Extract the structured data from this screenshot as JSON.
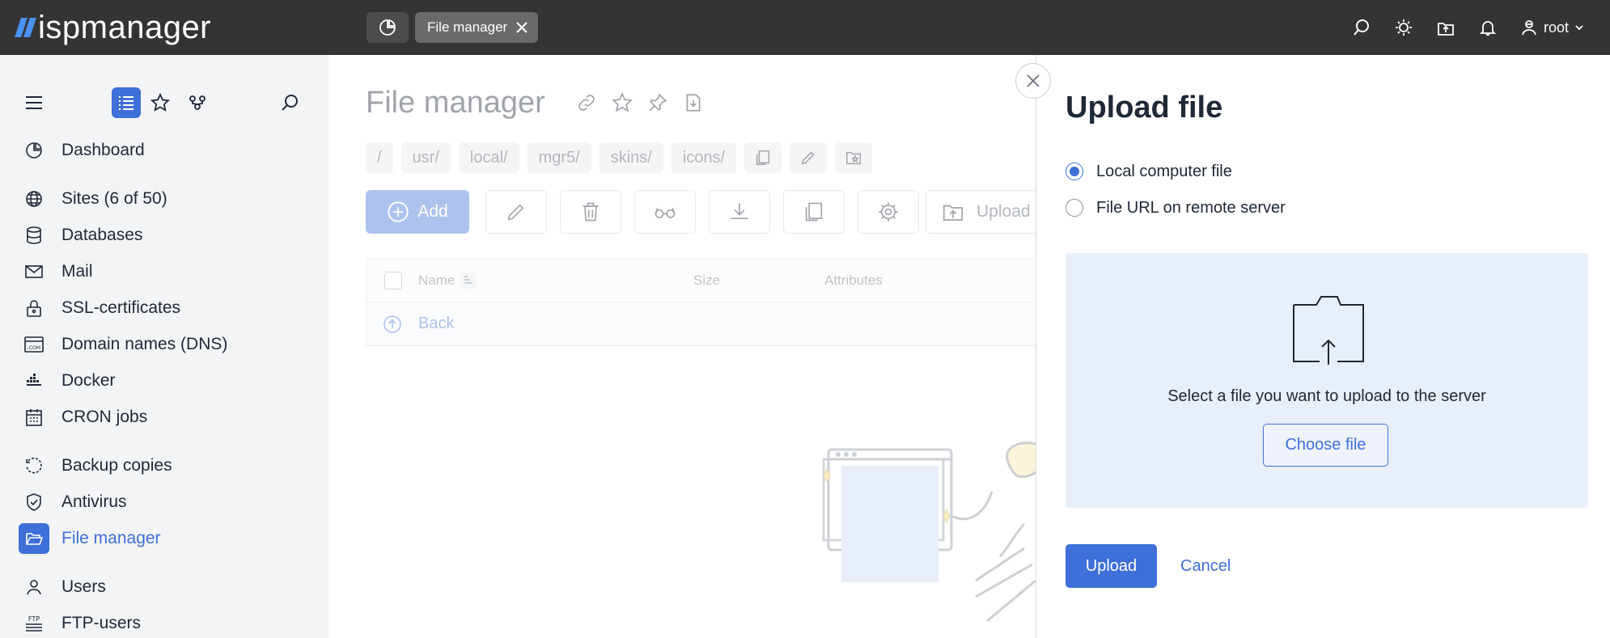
{
  "topbar": {
    "logo_text": "ispmanager",
    "tab_label": "File manager",
    "user_name": "root",
    "icons": [
      "dashboard-icon",
      "search-icon",
      "theme-sun-icon",
      "upload-icon",
      "bell-icon",
      "user-icon",
      "chevron-down-icon"
    ]
  },
  "sidebar": {
    "tools": [
      "menu-icon",
      "list-view-icon",
      "favorites-star-icon",
      "tree-icon",
      "search-icon"
    ],
    "items": [
      {
        "label": "Dashboard",
        "icon": "dashboard-icon"
      },
      {
        "label": "Sites (6 of 50)",
        "icon": "globe-icon"
      },
      {
        "label": "Databases",
        "icon": "database-icon"
      },
      {
        "label": "Mail",
        "icon": "mail-icon"
      },
      {
        "label": "SSL-certificates",
        "icon": "lock-icon"
      },
      {
        "label": "Domain names (DNS)",
        "icon": "dns-com-icon"
      },
      {
        "label": "Docker",
        "icon": "docker-icon"
      },
      {
        "label": "CRON jobs",
        "icon": "calendar-icon"
      },
      {
        "label": "Backup copies",
        "icon": "backup-icon"
      },
      {
        "label": "Antivirus",
        "icon": "shield-check-icon"
      },
      {
        "label": "File manager",
        "icon": "folder-open-icon",
        "active": true
      },
      {
        "label": "Users",
        "icon": "user-icon"
      },
      {
        "label": "FTP-users",
        "icon": "ftp-icon"
      }
    ]
  },
  "main": {
    "title": "File manager",
    "breadcrumbs": [
      "/",
      "usr/",
      "local/",
      "mgr5/",
      "skins/",
      "icons/"
    ],
    "toolbar": {
      "add_label": "Add",
      "upload_label": "Upload"
    },
    "table": {
      "columns": [
        "Name",
        "Size",
        "Attributes"
      ],
      "rows": [
        {
          "name": "Back"
        }
      ]
    }
  },
  "modal": {
    "title": "Upload file",
    "options": [
      {
        "label": "Local computer file",
        "selected": true
      },
      {
        "label": "File URL on remote server",
        "selected": false
      }
    ],
    "drop_text": "Select a file you want to upload to the server",
    "choose_label": "Choose file",
    "upload_label": "Upload",
    "cancel_label": "Cancel"
  },
  "colors": {
    "accent": "#3f6fd8",
    "topbar_bg": "#343434",
    "sidebar_bg": "#f3f4f6",
    "dropzone_bg": "#e9effa",
    "text": "#1f2837"
  }
}
